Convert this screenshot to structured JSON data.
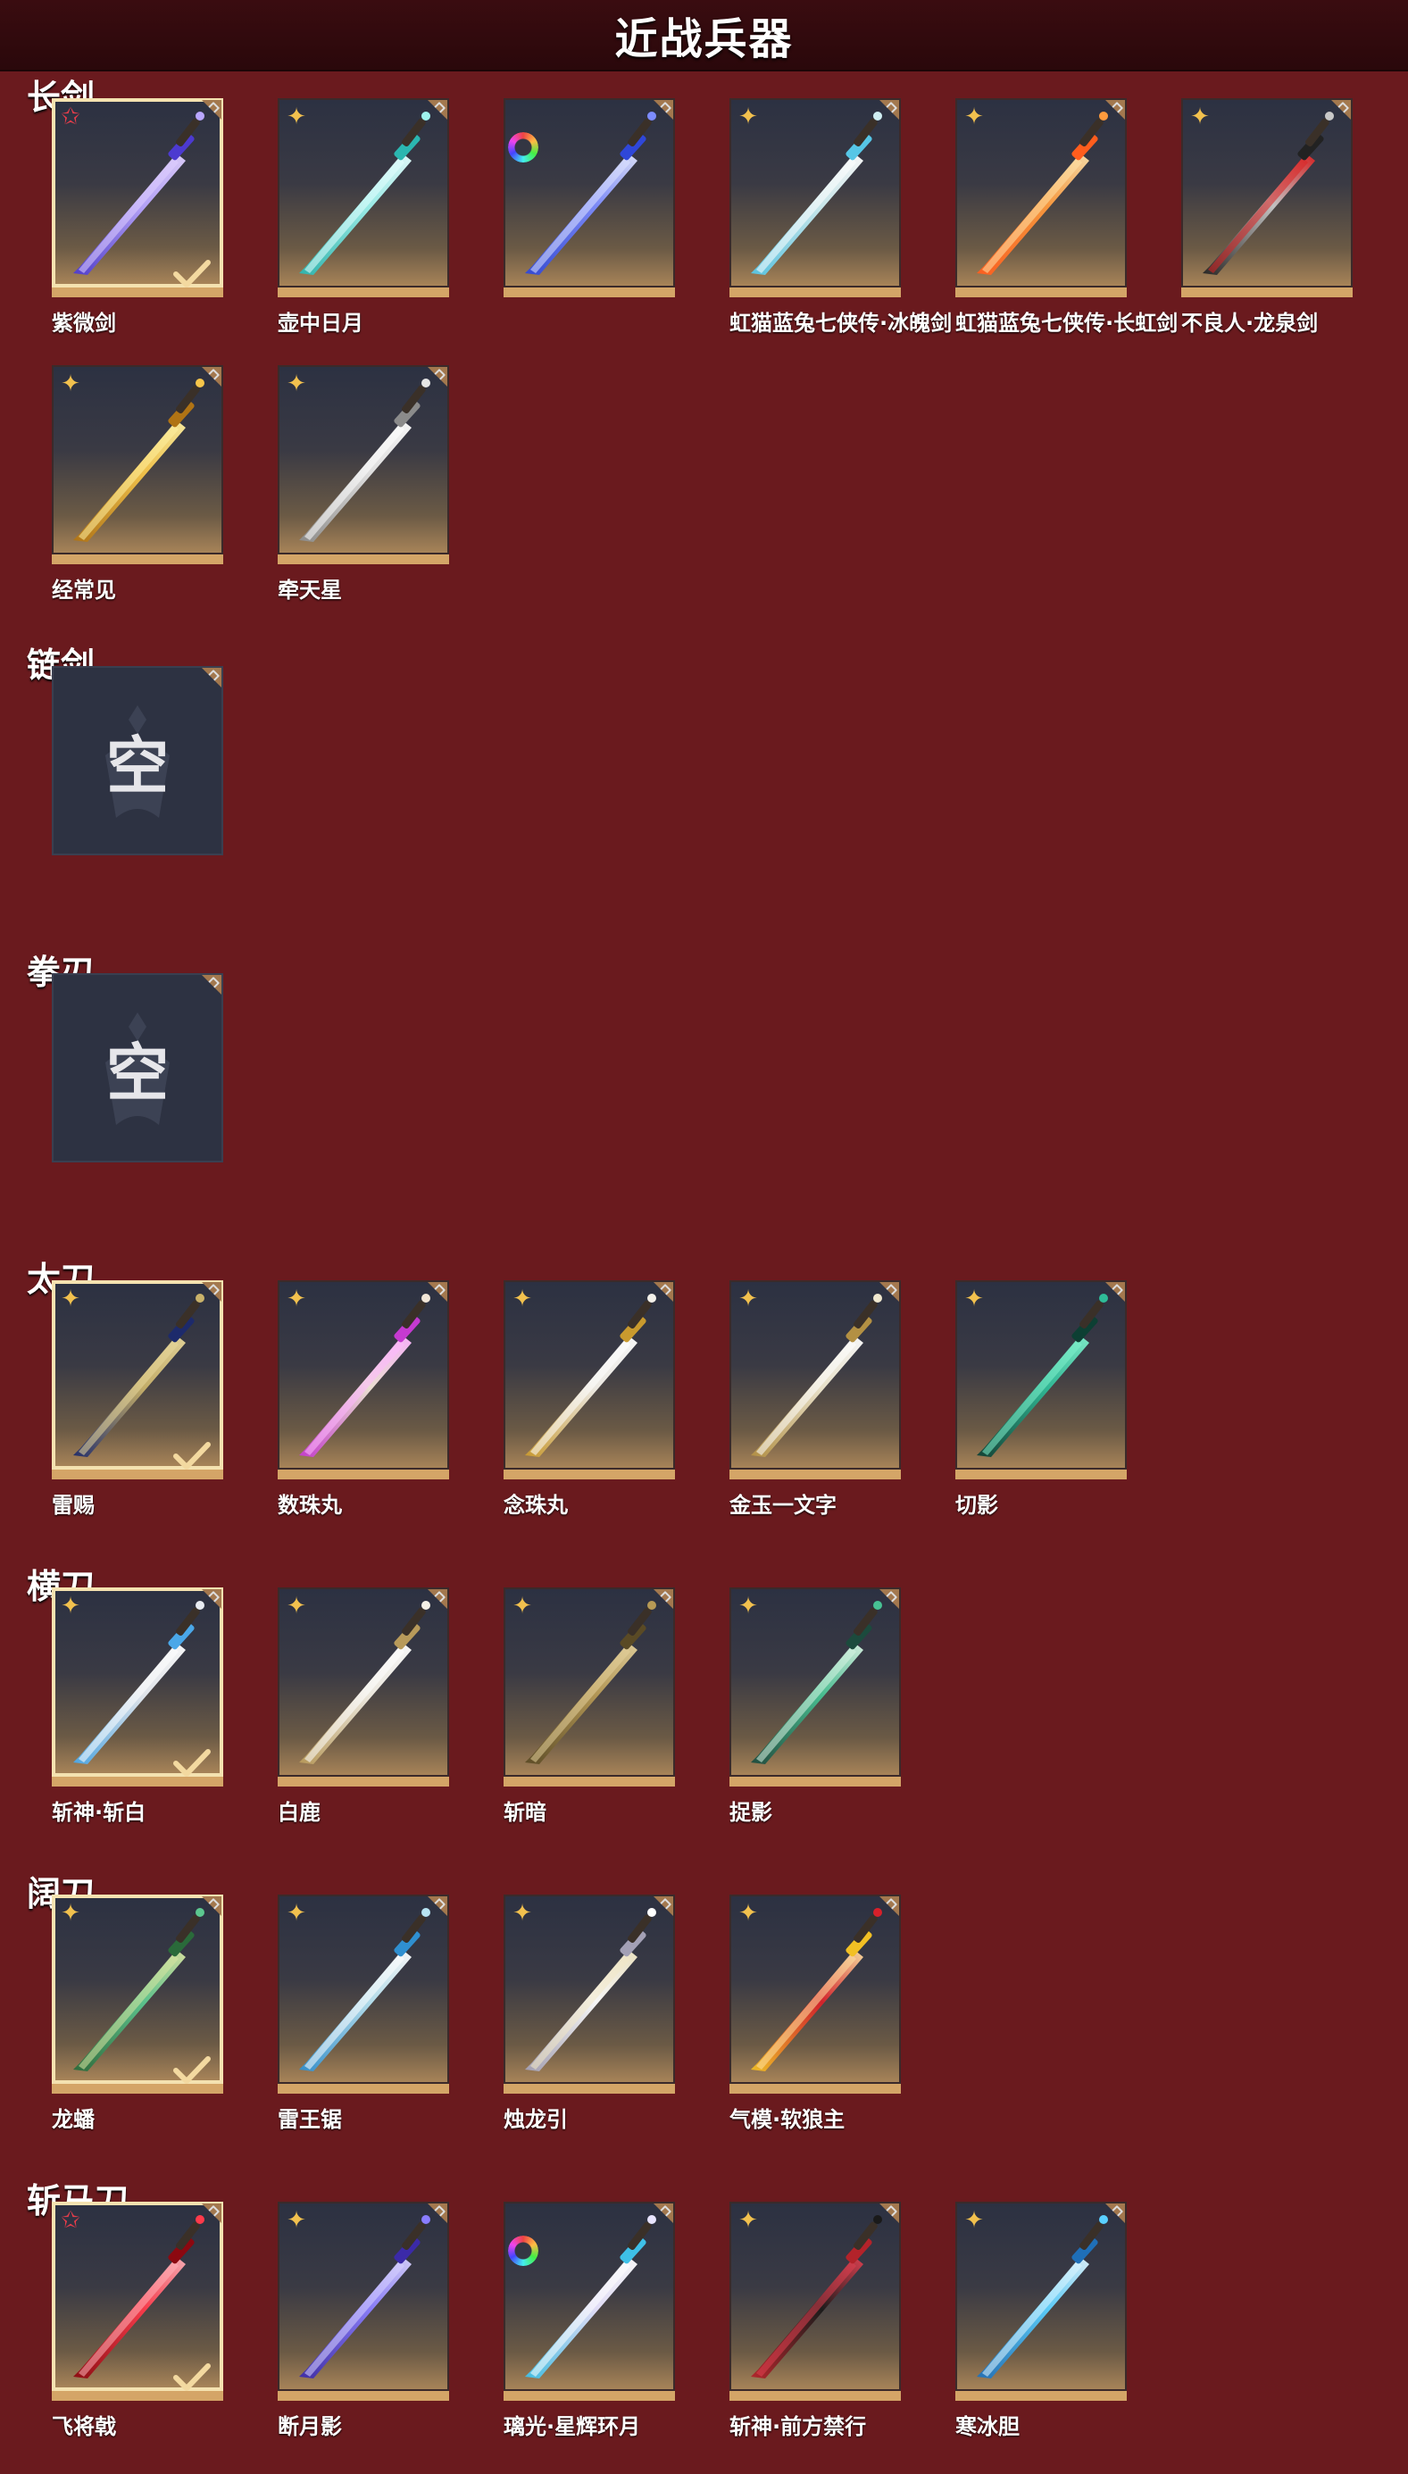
{
  "title": "近战兵器",
  "colors": {
    "background": "#6a1a1e",
    "accent": "#d4a567",
    "selected_border": "#f4e2b0"
  },
  "sections": [
    {
      "title": "长剑",
      "items": [
        {
          "name": "紫微剑",
          "badge": "red-star",
          "selected": true,
          "art": "violet-sword"
        },
        {
          "name": "壶中日月",
          "badge": "gold-star",
          "art": "cyan-sword"
        },
        {
          "name": "",
          "badge": "rainbow",
          "art": "blue-sword"
        },
        {
          "name": "虹猫蓝兔七侠传·冰魄剑",
          "badge": "gold-star",
          "art": "ice-sword"
        },
        {
          "name": "虹猫蓝兔七侠传·长虹剑",
          "badge": "gold-star",
          "art": "orange-sword"
        },
        {
          "name": "不良人·龙泉剑",
          "badge": "gold-star",
          "art": "red-black-sword"
        },
        {
          "name": "经常见",
          "badge": "gold-star",
          "art": "gold-sword"
        },
        {
          "name": "牵天星",
          "badge": "gold-star",
          "art": "silver-sword"
        }
      ]
    },
    {
      "title": "链剑",
      "items": [
        {
          "empty": true,
          "empty_label": "空"
        }
      ]
    },
    {
      "title": "拳刃",
      "items": [
        {
          "empty": true,
          "empty_label": "空"
        }
      ]
    },
    {
      "title": "太刀",
      "items": [
        {
          "name": "雷赐",
          "badge": "gold-star",
          "selected": true,
          "art": "navy-katana"
        },
        {
          "name": "数珠丸",
          "badge": "gold-star",
          "art": "pink-katana"
        },
        {
          "name": "念珠丸",
          "badge": "gold-star",
          "art": "white-gold-katana"
        },
        {
          "name": "金玉一文字",
          "badge": "gold-star",
          "art": "ivory-katana"
        },
        {
          "name": "切影",
          "badge": "gold-star",
          "art": "teal-katana"
        }
      ]
    },
    {
      "title": "横刀",
      "items": [
        {
          "name": "斩神·斩白",
          "badge": "gold-star",
          "selected": true,
          "art": "frost-blade"
        },
        {
          "name": "白鹿",
          "badge": "gold-star",
          "art": "white-blade"
        },
        {
          "name": "斩暗",
          "badge": "gold-star",
          "art": "bronze-blade"
        },
        {
          "name": "捉影",
          "badge": "gold-star",
          "art": "jade-blade"
        }
      ]
    },
    {
      "title": "阔刀",
      "items": [
        {
          "name": "龙蟠",
          "badge": "gold-star",
          "selected": true,
          "art": "jade-broadsword"
        },
        {
          "name": "雷王锯",
          "badge": "gold-star",
          "art": "thunder-broadsword"
        },
        {
          "name": "烛龙引",
          "badge": "gold-star",
          "art": "white-broadsword"
        },
        {
          "name": "气模·软狼主",
          "badge": "gold-star",
          "art": "red-broadsword"
        }
      ]
    },
    {
      "title": "斩马刀",
      "items": [
        {
          "name": "飞将戟",
          "badge": "red-star",
          "selected": true,
          "art": "crimson-glaive"
        },
        {
          "name": "断月影",
          "badge": "gold-star",
          "art": "purple-glaive"
        },
        {
          "name": "璃光·星辉环月",
          "badge": "rainbow",
          "art": "moon-glaive"
        },
        {
          "name": "斩神·前方禁行",
          "badge": "gold-star",
          "art": "sign-glaive"
        },
        {
          "name": "寒冰胆",
          "badge": "gold-star",
          "art": "ice-glaive"
        }
      ]
    }
  ]
}
